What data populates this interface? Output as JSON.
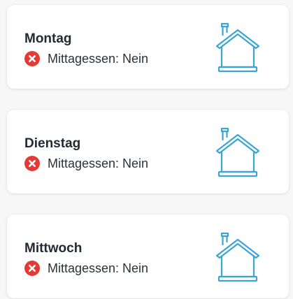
{
  "colors": {
    "status_no": "#e53935",
    "house_stroke": "#3aa4d6"
  },
  "days": [
    {
      "name": "Montag",
      "status_label": "Mittagessen: Nein",
      "status_icon": "x-circle-icon",
      "location_icon": "house-icon"
    },
    {
      "name": "Dienstag",
      "status_label": "Mittagessen: Nein",
      "status_icon": "x-circle-icon",
      "location_icon": "house-icon"
    },
    {
      "name": "Mittwoch",
      "status_label": "Mittagessen: Nein",
      "status_icon": "x-circle-icon",
      "location_icon": "house-icon"
    }
  ]
}
